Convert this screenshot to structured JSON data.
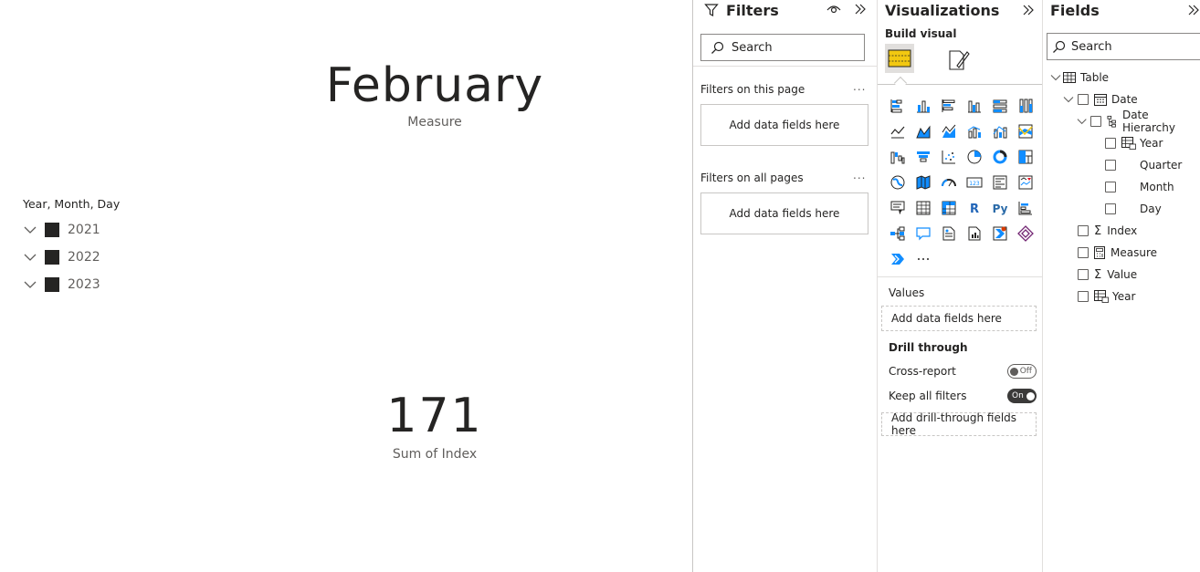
{
  "canvas": {
    "card_month": {
      "value": "February",
      "label": "Measure"
    },
    "card_index": {
      "value": "171",
      "label": "Sum of Index"
    },
    "slicer": {
      "header": "Year, Month, Day",
      "items": [
        {
          "label": "2021"
        },
        {
          "label": "2022"
        },
        {
          "label": "2023"
        }
      ]
    }
  },
  "filters": {
    "title": "Filters",
    "search_placeholder": "Search",
    "on_page_label": "Filters on this page",
    "on_page_drop": "Add data fields here",
    "all_pages_label": "Filters on all pages",
    "all_pages_drop": "Add data fields here",
    "more": "..."
  },
  "visualizations": {
    "title": "Visualizations",
    "build_visual": "Build visual",
    "more_visuals": "···",
    "values_label": "Values",
    "values_drop": "Add data fields here",
    "drill_through_label": "Drill through",
    "cross_report_label": "Cross-report",
    "cross_report_state": "Off",
    "keep_filters_label": "Keep all filters",
    "keep_filters_state": "On",
    "drill_drop": "Add drill-through fields here",
    "icons": [
      "stacked-bar-chart-icon",
      "stacked-column-chart-icon",
      "clustered-bar-chart-icon",
      "clustered-column-chart-icon",
      "100-stacked-bar-chart-icon",
      "100-stacked-column-chart-icon",
      "line-chart-icon",
      "area-chart-icon",
      "stacked-area-chart-icon",
      "line-stacked-column-icon",
      "line-clustered-column-icon",
      "ribbon-chart-icon",
      "waterfall-chart-icon",
      "funnel-icon",
      "scatter-chart-icon",
      "pie-chart-icon",
      "donut-chart-icon",
      "treemap-icon",
      "map-icon",
      "filled-map-icon",
      "gauge-icon",
      "card-icon",
      "multirow-card-icon",
      "kpi-icon",
      "slicer-icon",
      "table-icon",
      "matrix-icon",
      "r-visual-icon",
      "python-visual-icon",
      "key-influencers-icon",
      "decomposition-tree-icon",
      "qa-icon",
      "smart-narrative-icon",
      "paginated-report-icon",
      "power-automate-icon",
      "power-apps-icon",
      "more-visuals-chevron-icon",
      "more-icon"
    ]
  },
  "fields": {
    "title": "Fields",
    "search_placeholder": "Search",
    "table_name": "Table",
    "date": "Date",
    "date_hierarchy": "Date Hierarchy",
    "year_h": "Year",
    "quarter": "Quarter",
    "month": "Month",
    "day": "Day",
    "index": "Index",
    "measure": "Measure",
    "value": "Value",
    "year": "Year"
  },
  "colors": {
    "accent_yellow": "#F2C811",
    "chart_blue": "#118DFF",
    "text": "#252423"
  }
}
